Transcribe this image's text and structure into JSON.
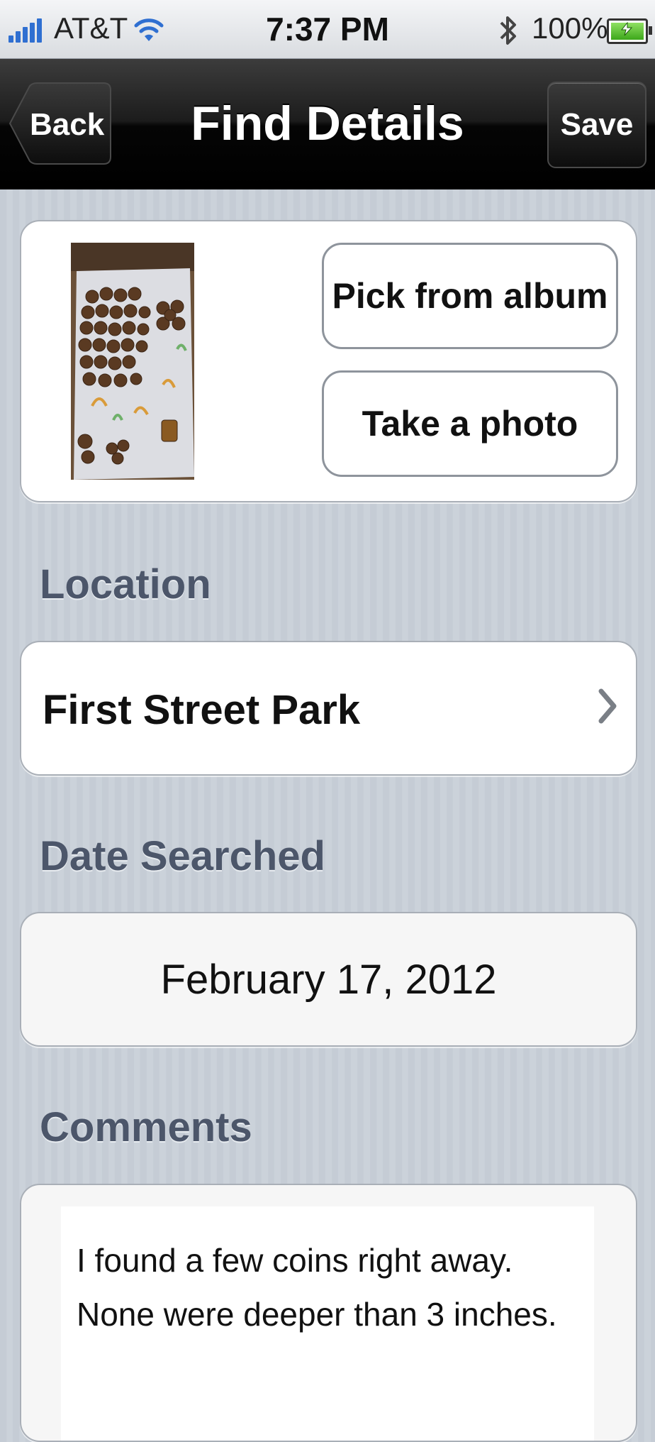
{
  "status_bar": {
    "carrier": "AT&T",
    "time": "7:37 PM",
    "battery": "100%",
    "icons": [
      "signal-icon",
      "wifi-icon",
      "bluetooth-icon",
      "battery-charging-icon"
    ]
  },
  "nav": {
    "title": "Find Details",
    "back_label": "Back",
    "save_label": "Save"
  },
  "photo": {
    "pick_album_label": "Pick from album",
    "take_photo_label": "Take a photo"
  },
  "location": {
    "label": "Location",
    "value": "First Street Park"
  },
  "date": {
    "label": "Date Searched",
    "value": "February 17, 2012"
  },
  "comments": {
    "label": "Comments",
    "value": "I found a few coins right away. None were deeper than 3 inches."
  },
  "colors": {
    "nav_bar": "#000000",
    "section_label": "#4c566a",
    "background": "#c5ccd5",
    "signal": "#2f6fd1",
    "battery_fill": "#3da71a"
  }
}
